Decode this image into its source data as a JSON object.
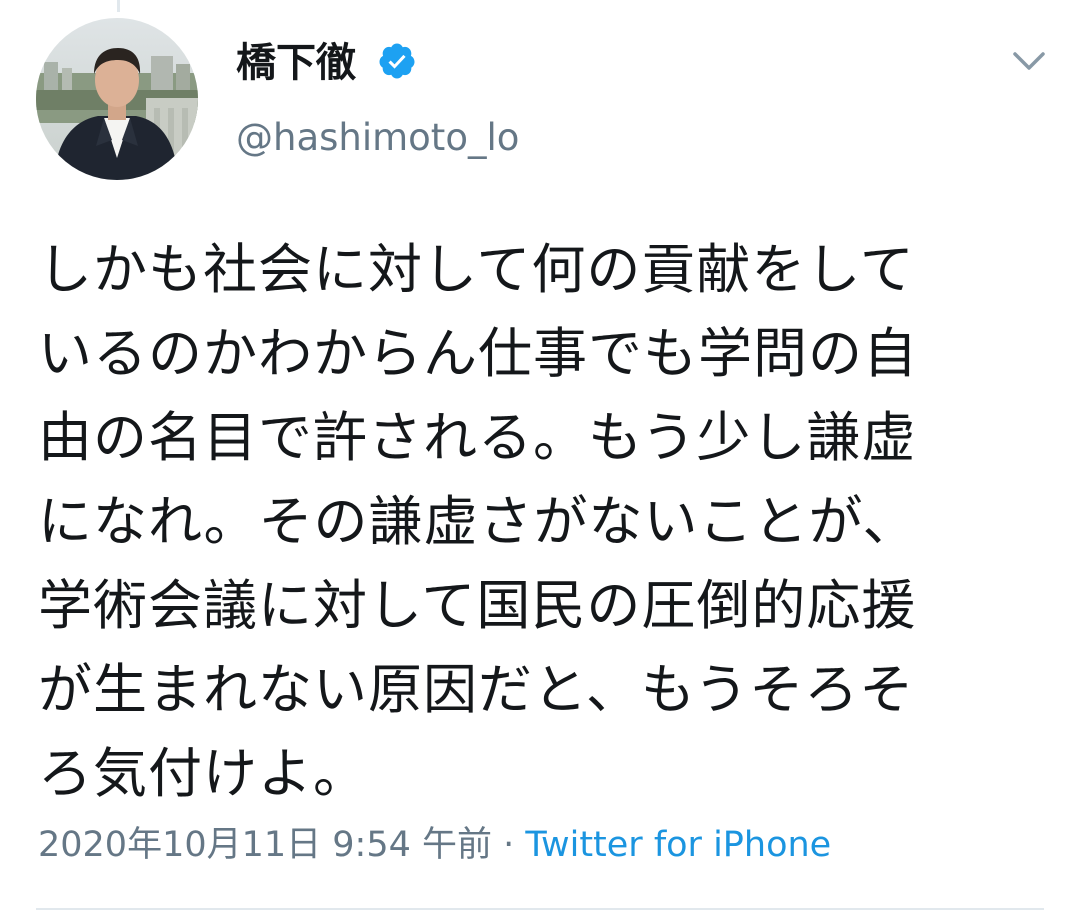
{
  "tweet": {
    "author": {
      "display_name": "橋下徹",
      "handle": "@hashimoto_lo",
      "verified": true
    },
    "text": "しかも社会に対して何の貢献をして\nいるのかわからん仕事でも学問の自\n由の名目で許される。もう少し謙虚\nになれ。その謙虚さがないことが、\n学術会議に対して国民の圧倒的応援\nが生まれない原因だと、もうそろそ\nろ気付けよ。",
    "timestamp": "2020年10月11日 9:54 午前",
    "separator": " · ",
    "source": "Twitter for iPhone"
  },
  "icons": {
    "verified": "verified-badge-icon",
    "menu": "chevron-down-icon"
  },
  "colors": {
    "text": "#14171a",
    "secondary": "#657786",
    "link": "#1b95e0",
    "verified": "#1da1f2",
    "divider": "#e1e8ed"
  }
}
